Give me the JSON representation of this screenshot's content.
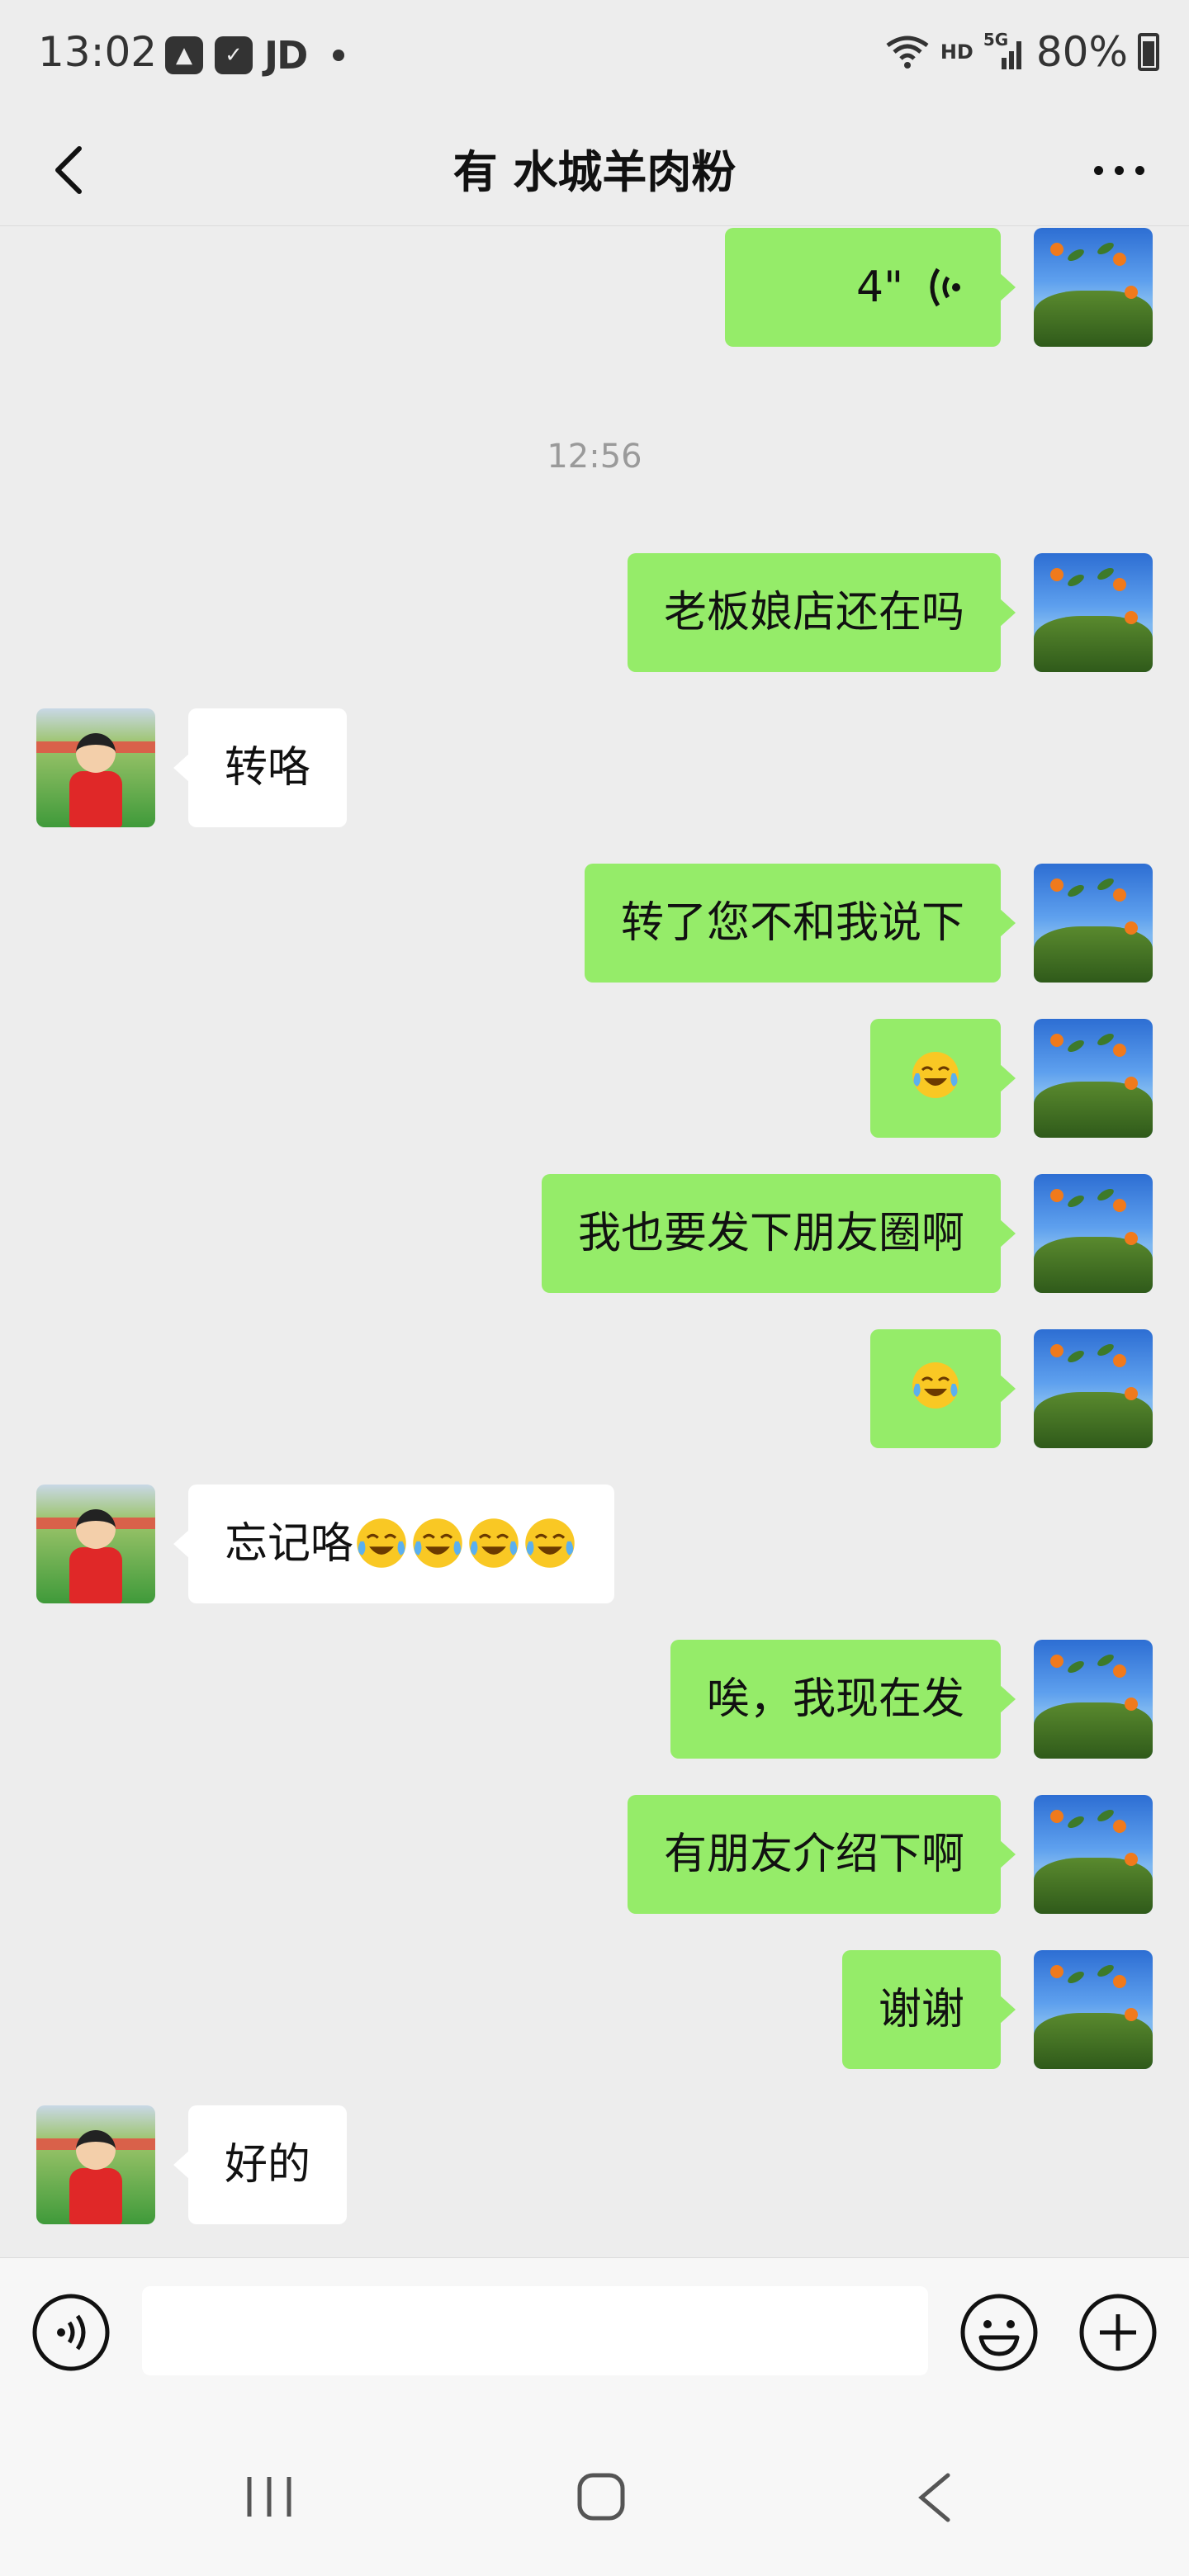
{
  "status_bar": {
    "time": "13:02",
    "carrier_text": "JD",
    "network_label": "HD",
    "network_gen": "5G",
    "battery": "80%"
  },
  "header": {
    "title": "有 水城羊肉粉",
    "back_icon": "chevron-left-icon",
    "more_icon": "more-dots-icon"
  },
  "chat": {
    "timestamp": "12:56",
    "messages": [
      {
        "from": "me",
        "type": "voice",
        "duration": "4\""
      },
      {
        "from": "me",
        "type": "text",
        "text": "老板娘店还在吗"
      },
      {
        "from": "other",
        "type": "text",
        "text": "转咯"
      },
      {
        "from": "me",
        "type": "text",
        "text": "转了您不和我说下"
      },
      {
        "from": "me",
        "type": "emoji",
        "emoji": "[破涕为笑]"
      },
      {
        "from": "me",
        "type": "text",
        "text": "我也要发下朋友圈啊"
      },
      {
        "from": "me",
        "type": "emoji",
        "emoji": "[破涕为笑]"
      },
      {
        "from": "other",
        "type": "text",
        "text": "忘记咯"
      },
      {
        "from": "me",
        "type": "text",
        "text": "唉，我现在发"
      },
      {
        "from": "me",
        "type": "text",
        "text": "有朋友介绍下啊"
      },
      {
        "from": "me",
        "type": "text",
        "text": "谢谢"
      },
      {
        "from": "other",
        "type": "text",
        "text": "好的"
      }
    ]
  },
  "input_bar": {
    "placeholder": "",
    "voice_icon": "voice-input-icon",
    "emoji_icon": "smiley-icon",
    "plus_icon": "plus-circle-icon"
  },
  "colors": {
    "background": "#ededed",
    "my_bubble": "#95ec69",
    "other_bubble": "#ffffff",
    "timestamp": "#9a9a9a"
  }
}
